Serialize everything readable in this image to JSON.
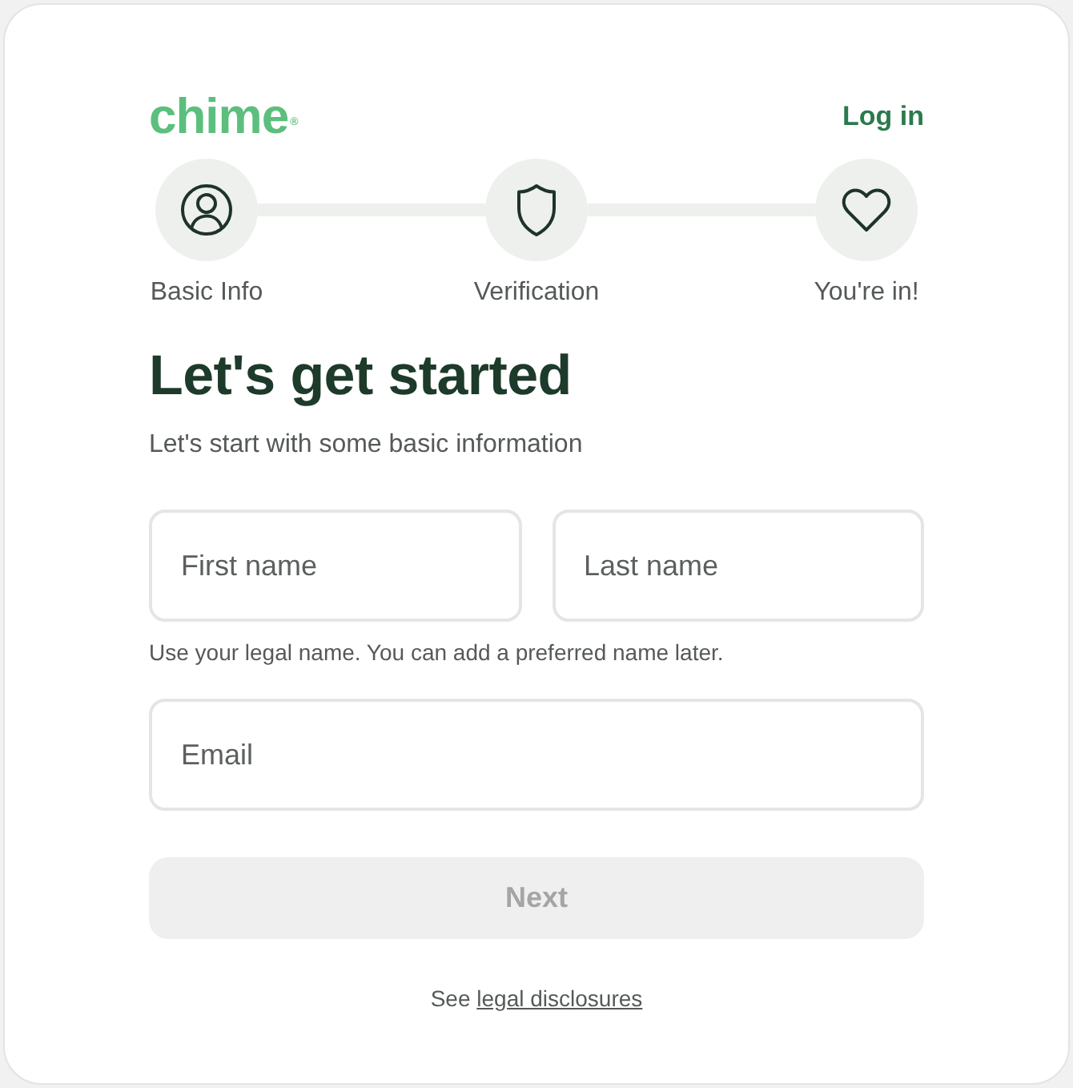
{
  "header": {
    "logo": "chime$^{®}$",
    "login_link": "Log in"
  },
  "steps": [
    {
      "label": "Basic Info"
    },
    {
      "label": "Verification"
    },
    {
      "label": "You're in!"
    }
  ],
  "title": "Let's get started",
  "subtitle": "Let's start with some basic information",
  "name_fields": [
    {
      "placeholder": "First name"
    },
    {
      "placeholder": "Last name"
    }
  ],
  "name_hint": "Use your legal name. You can add a preferred name later.",
  "email_field": {
    "placeholder": "Email"
  },
  "next_button": {
    "label": "Next",
    "disabled": true
  },
  "legal": {
    "prefix": "See",
    "link": "legal disclosures"
  }
}
